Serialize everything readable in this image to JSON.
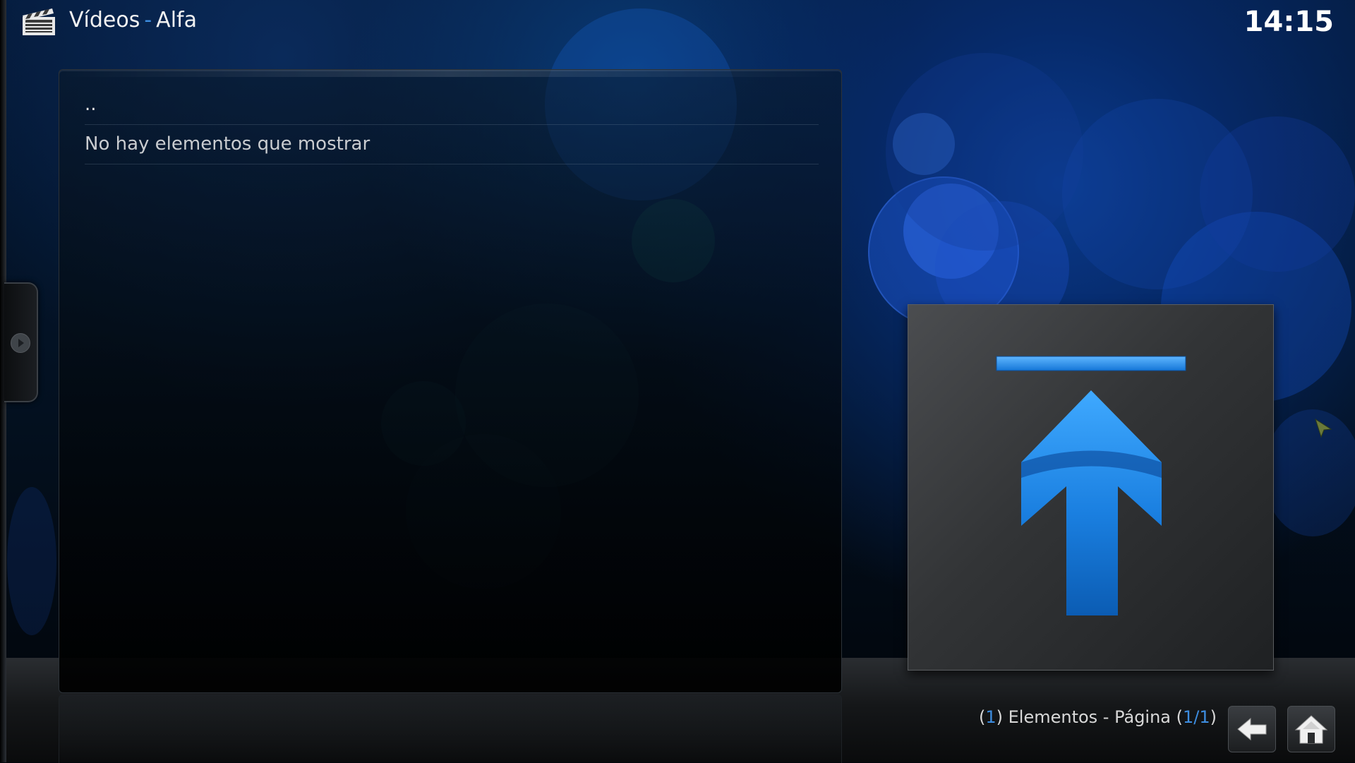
{
  "header": {
    "section": "Vídeos",
    "separator": "-",
    "location": "Alfa",
    "clock": "14:15",
    "icon": "clapperboard-icon"
  },
  "list": {
    "parent_item": "..",
    "empty_message": "No hay elementos que mostrar"
  },
  "thumbnail": {
    "icon": "arrow-up-to-top-icon",
    "accent_color": "#1e88e5"
  },
  "footer": {
    "open_paren": "(",
    "item_count": "1",
    "items_text": ") Elementos - Página (",
    "page": "1/1",
    "close_paren": ")"
  },
  "buttons": {
    "back_icon": "back-arrow-icon",
    "home_icon": "home-icon"
  },
  "colors": {
    "accent": "#3d8de0",
    "background": "#03101f"
  }
}
